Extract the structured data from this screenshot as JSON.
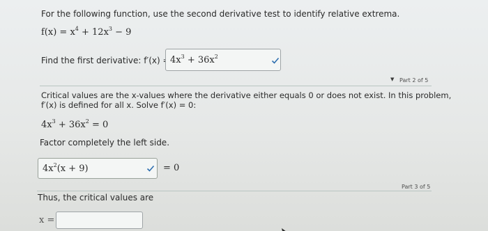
{
  "part1": {
    "instruction": "For the following function, use the second derivative test to identify relative extrema.",
    "function_lhs": "f(x) = x",
    "function_exp1": "4",
    "function_mid": " + 12x",
    "function_exp2": "3",
    "function_end": " − 9",
    "first_derivative_prompt": "Find the first derivative: f′(x) =",
    "first_derivative_value": "4x",
    "first_derivative_exp1": "3",
    "first_derivative_mid": " + 36x",
    "first_derivative_exp2": "2"
  },
  "part2": {
    "label": "Part 2 of 5",
    "critical_text_line1": "Critical values are the x-values where the derivative either equals 0 or does not exist. In this problem,",
    "critical_text_line2": "f′(x) is defined for all x. Solve f′(x) = 0:",
    "equation_a": "4x",
    "equation_exp1": "3",
    "equation_b": " + 36x",
    "equation_exp2": "2",
    "equation_c": " = 0",
    "factor_prompt": "Factor completely the left side.",
    "factor_value_a": "4x",
    "factor_exp": "2",
    "factor_value_b": "(x + 9)",
    "equals_zero": "= 0"
  },
  "part3": {
    "label": "Part 3 of 5",
    "critical_values_text": "Thus, the critical values are",
    "x_equals": "x =",
    "answer_value": ""
  },
  "colors": {
    "background": "#e8eae9",
    "rule": "#b9c5c1",
    "check": "#2f6fb0"
  }
}
